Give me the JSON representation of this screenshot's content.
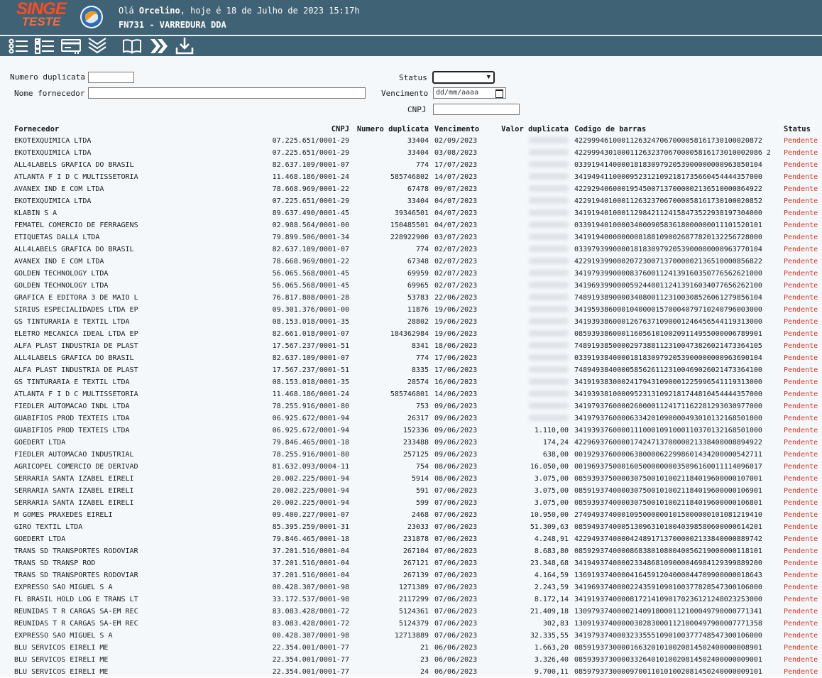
{
  "app": {
    "logo_line1": "SINGE",
    "logo_line2": "TESTE",
    "greeting_prefix": "Olá ",
    "user": "Orcelino",
    "greeting_suffix": ", hoje é 18 de Julho de 2023 15:17h",
    "screen_title": "FN731 - VARREDURA DDA"
  },
  "toolbar": {
    "icons": [
      "list-icon",
      "checklist-icon",
      "card-icon",
      "double-chevron-down-icon",
      "book-icon",
      "double-chevron-right-icon",
      "download-icon"
    ]
  },
  "filters": {
    "numero_duplicata_label": "Numero duplicata",
    "nome_fornecedor_label": "Nome fornecedor",
    "status_label": "Status",
    "vencimento_label": "Vencimento",
    "vencimento_placeholder": "dd/mm/aaaa",
    "cnpj_label": "CNPJ"
  },
  "table": {
    "headers": {
      "fornecedor": "Fornecedor",
      "cnpj": "CNPJ",
      "numero": "Numero duplicata",
      "vencimento": "Vencimento",
      "valor": "Valor duplicata",
      "barras": "Codigo de barras",
      "status": "Status"
    },
    "rows": [
      [
        "EKOTEXQUIMICA LTDA",
        "07.225.651/0001-29",
        "33404",
        "02/09/2023",
        "",
        "42299946100011263247067000058161730100020872",
        "Pendente"
      ],
      [
        "EKOTEXQUIMICA LTDA",
        "07.225.651/0001-29",
        "33404",
        "03/08/2023",
        "",
        "42299943010001126323706700005816173010002086 2",
        "Pendente"
      ],
      [
        "ALL4LABELS GRAFICA DO BRASIL",
        "82.637.109/0001-07",
        "774",
        "17/07/2023",
        "",
        "03391941400001818309792053900000000963850104",
        "Pendente"
      ],
      [
        "ATLANTA F I D C MULTISSETORIA",
        "11.468.186/0001-24",
        "585746802",
        "14/07/2023",
        "",
        "34194941100009523121092181735660454444357000",
        "Pendente"
      ],
      [
        "AVANEX IND E COM LTDA",
        "78.668.969/0001-22",
        "67478",
        "09/07/2023",
        "",
        "42292940600019545007137000002136510000864922",
        "Pendente"
      ],
      [
        "EKOTEXQUIMICA LTDA",
        "07.225.651/0001-29",
        "33404",
        "04/07/2023",
        "",
        "42291940100011263237067000058161730100020852",
        "Pendente"
      ],
      [
        "KLABIN S A",
        "89.637.490/0001-45",
        "39346501",
        "04/07/2023",
        "",
        "34191940100011298421124158473522938197304000",
        "Pendente"
      ],
      [
        "FEMATEL COMERCIO DE FERRAGENS",
        "02.988.564/0001-00",
        "150485501",
        "04/07/2023",
        "",
        "03391940100003400090583618000000011101520101",
        "Pendente"
      ],
      [
        "ETIQUETAS DALLA LTDA",
        "79.899.506/0001-34",
        "228922900",
        "03/07/2023",
        "",
        "34191940000000081881090026877820132256728000",
        "Pendente"
      ],
      [
        "ALL4LABELS GRAFICA DO BRASIL",
        "82.637.109/0001-07",
        "774",
        "02/07/2023",
        "",
        "03397939900001818309792053900000000963770104",
        "Pendente"
      ],
      [
        "AVANEX IND E COM LTDA",
        "78.668.969/0001-22",
        "67348",
        "02/07/2023",
        "",
        "42291939900020723007137000002136510000856822",
        "Pendente"
      ],
      [
        "GOLDEN TECHNOLOGY LTDA",
        "56.065.568/0001-45",
        "69959",
        "02/07/2023",
        "",
        "34197939900008376001124139160350776562621000",
        "Pendente"
      ],
      [
        "GOLDEN TECHNOLOGY LTDA",
        "56.065.568/0001-45",
        "69965",
        "02/07/2023",
        "",
        "34196939900005924400112413916034077656262100",
        "Pendente"
      ],
      [
        "GRAFICA E EDITORA 3 DE MAIO L",
        "76.817.808/0001-28",
        "53783",
        "22/06/2023",
        "",
        "74891938900003408001123100308526061279856104",
        "Pendente"
      ],
      [
        "SIRIUS ESPECIALIDADES LTDA EP",
        "09.301.376/0001-00",
        "11876",
        "19/06/2023",
        "",
        "34195938600010400001570004079710240796003000",
        "Pendente"
      ],
      [
        "GS TINTURARIA E TEXTIL LTDA",
        "08.153.018/0001-35",
        "28802",
        "19/06/2023",
        "",
        "34193938600012676371090001246456544119313000",
        "Pendente"
      ],
      [
        "ELETRO MECANICA IDEAL LTDA EP",
        "82.661.018/0001-07",
        "184362984",
        "19/06/2023",
        "",
        "08593938600011605610100209114955000006789901",
        "Pendente"
      ],
      [
        "ALFA PLAST INDUSTRIA DE PLAST",
        "17.567.237/0001-51",
        "8341",
        "18/06/2023",
        "",
        "74891938500002973881123100473826021473364105",
        "Pendente"
      ],
      [
        "ALL4LABELS GRAFICA DO BRASIL",
        "82.637.109/0001-07",
        "774",
        "17/06/2023",
        "",
        "03391938400001818309792053900000000963690104",
        "Pendente"
      ],
      [
        "ALFA PLAST INDUSTRIA DE PLAST",
        "17.567.237/0001-51",
        "8335",
        "17/06/2023",
        "",
        "74894938400005856261123100469026021473364100",
        "Pendente"
      ],
      [
        "GS TINTURARIA E TEXTIL LTDA",
        "08.153.018/0001-35",
        "28574",
        "16/06/2023",
        "",
        "34191938300024179431090001225996541119313000",
        "Pendente"
      ],
      [
        "ATLANTA F I D C MULTISSETORIA",
        "11.468.186/0001-24",
        "585746801",
        "14/06/2023",
        "",
        "34193938100009523131092181744810454444357000",
        "Pendente"
      ],
      [
        "FIEDLER AUTOMACAO INDL LTDA",
        "78.255.916/0001-80",
        "753",
        "09/06/2023",
        "",
        "34197937600002600001124171162281293030977000",
        "Pendente"
      ],
      [
        "GUABIFIOS PROD TEXTEIS LTDA",
        "06.925.672/0001-94",
        "26317",
        "09/06/2023",
        "",
        "34197937600006334201090000493010132168501000",
        "Pendente"
      ],
      [
        "GUABIFIOS PROD TEXTEIS LTDA",
        "06.925.672/0001-94",
        "152336",
        "09/06/2023",
        "1.110,00",
        "34193937600001110001091000110370132168501000",
        "Pendente"
      ],
      [
        "GOEDERT LTDA",
        "79.846.465/0001-18",
        "233488",
        "09/06/2023",
        "174,24",
        "42296937600001742471370000021338400008894922",
        "Pendente"
      ],
      [
        "FIEDLER AUTOMACAO INDUSTRIAL",
        "78.255.916/0001-80",
        "257125",
        "09/06/2023",
        "638,00",
        "00192937600006380000622998601434200000542711",
        "Pendente"
      ],
      [
        "AGRICOPEL COMERCIO DE DERIVAD",
        "81.632.093/0004-11",
        "754",
        "08/06/2023",
        "16.050,00",
        "00196937500016050000000035096160011114096017",
        "Pendente"
      ],
      [
        "SERRARIA SANTA IZABEL EIRELI",
        "20.002.225/0001-94",
        "5914",
        "08/06/2023",
        "3.075,00",
        "08593937500003075001010021184019600000107001",
        "Pendente"
      ],
      [
        "SERRARIA SANTA IZABEL EIRELI",
        "20.002.225/0001-94",
        "591",
        "07/06/2023",
        "3.075,00",
        "08591937400003075001010021184019600000106901",
        "Pendente"
      ],
      [
        "SERRARIA SANTA IZABEL EIRELI",
        "20.002.225/0001-94",
        "599",
        "07/06/2023",
        "3.075,00",
        "08593937400003075001010021184019600000106801",
        "Pendente"
      ],
      [
        "M GOMES PRAXEDES EIRELI",
        "09.400.227/0001-07",
        "2468",
        "07/06/2023",
        "10.950,00",
        "27494937400010950000001015000000101081219410",
        "Pendente"
      ],
      [
        "GIRO TEXTIL LTDA",
        "85.395.259/0001-31",
        "23033",
        "07/06/2023",
        "51.309,63",
        "08594937400051309631010040398580600000614201",
        "Pendente"
      ],
      [
        "GOEDERT LTDA",
        "79.846.465/0001-18",
        "231878",
        "07/06/2023",
        "4.248,91",
        "42294937400004248917137000002133840000889742",
        "Pendente"
      ],
      [
        "TRANS SD TRANSPORTES RODOVIAR",
        "37.201.516/0001-04",
        "267104",
        "07/06/2023",
        "8.683,80",
        "08592937400008683801080040056219000000118101",
        "Pendente"
      ],
      [
        "TRANS SD TRANSP ROD",
        "37.201.516/0001-04",
        "267121",
        "07/06/2023",
        "23.348,68",
        "34194937400002334868109000046984129399889200",
        "Pendente"
      ],
      [
        "TRANS SD TRANSPORTES RODOVIAR",
        "37.201.516/0001-04",
        "267139",
        "07/06/2023",
        "4.164,59",
        "13691937400004164591204000044709900000018643",
        "Pendente"
      ],
      [
        "EXPRESSO SAO MIGUEL S A",
        "00.428.307/0001-98",
        "1271389",
        "07/06/2023",
        "2.243,59",
        "34196937400002243591090100377828547300106000",
        "Pendente"
      ],
      [
        "FL BRASIL HOLD LOG E TRANS LT",
        "33.172.537/0001-98",
        "2117299",
        "07/06/2023",
        "8.172,14",
        "34191937400008172141090170236121248023253000",
        "Pendente"
      ],
      [
        "REUNIDAS T R CARGAS SA-EM REC",
        "83.083.428/0001-72",
        "5124361",
        "07/06/2023",
        "21.409,18",
        "13097937400002140918000112100049790000771341",
        "Pendente"
      ],
      [
        "REUNIDAS T R CARGAS SA-EM REC",
        "83.083.428/0001-72",
        "5124379",
        "07/06/2023",
        "302,83",
        "13091937400000302830001121000497900007771358",
        "Pendente"
      ],
      [
        "EXPRESSO SAO MIGUEL S A",
        "00.428.307/0001-98",
        "12713889",
        "07/06/2023",
        "32.335,55",
        "34197937400032335551090100377748547300106000",
        "Pendente"
      ],
      [
        "BLU SERVICOS EIRELI ME",
        "22.354.001/0001-77",
        "21",
        "06/06/2023",
        "1.663,20",
        "08591937300001663201010020814502400000008901",
        "Pendente"
      ],
      [
        "BLU SERVICOS EIRELI ME",
        "22.354.001/0001-77",
        "23",
        "06/06/2023",
        "3.326,40",
        "08593937300003326401010020814502400000009001",
        "Pendente"
      ],
      [
        "BLU SERVICOS EIRELI ME",
        "22.354.001/0001-77",
        "24",
        "06/06/2023",
        "9.700,11",
        "08597937300009700110101002081450240000009101",
        "Pendente"
      ]
    ]
  }
}
